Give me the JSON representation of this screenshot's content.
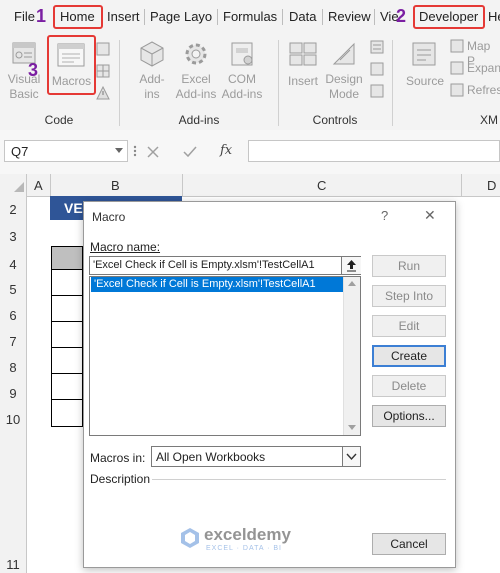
{
  "ribbon_tabs": [
    "File",
    "Home",
    "Insert",
    "Page Layo",
    "Formulas",
    "Data",
    "Review",
    "Vie",
    "Developer",
    "He"
  ],
  "step_numbers": [
    "1",
    "2",
    "3"
  ],
  "code_group": {
    "visual_basic": [
      "Visual",
      "Basic"
    ],
    "macros": "Macros",
    "label": "Code"
  },
  "addins_group": {
    "addins": [
      "Add-",
      "ins"
    ],
    "excel_addins": [
      "Excel",
      "Add-ins"
    ],
    "com_addins": [
      "COM",
      "Add-ins"
    ],
    "label": "Add-ins"
  },
  "controls_group": {
    "insert": "Insert",
    "design_mode": [
      "Design",
      "Mode"
    ],
    "label": "Controls"
  },
  "xml_group": {
    "source": "Source",
    "map_p": "Map P",
    "expan": "Expan",
    "refres": "Refres",
    "label": "XM"
  },
  "formula_bar": {
    "name_box": "Q7",
    "fx": "fx"
  },
  "sheet": {
    "columns": [
      "A",
      "B",
      "C",
      "D"
    ],
    "rows": [
      "2",
      "3",
      "4",
      "5",
      "6",
      "7",
      "8",
      "9",
      "10",
      "11"
    ],
    "b2_partial": "VE"
  },
  "dialog": {
    "title": "Macro",
    "help": "?",
    "close": "✕",
    "macro_name_label": "Macro name:",
    "macro_name_value": "'Excel Check if Cell is Empty.xlsm'!TestCellA1",
    "list_items": [
      "'Excel Check if Cell is Empty.xlsm'!TestCellA1"
    ],
    "buttons": {
      "run": "Run",
      "step_into": "Step Into",
      "edit": "Edit",
      "create": "Create",
      "delete": "Delete",
      "options": "Options...",
      "cancel": "Cancel"
    },
    "macros_in_label": "Macros in:",
    "macros_in_value": "All Open Workbooks",
    "description_label": "Description"
  },
  "watermark": {
    "name": "exceldemy",
    "tagline": "EXCEL · DATA · BI"
  },
  "colors": {
    "highlight_red": "#e53935",
    "step_purple": "#7b1fa2",
    "selection_blue": "#0078d7",
    "header_blue": "#2f5597"
  }
}
